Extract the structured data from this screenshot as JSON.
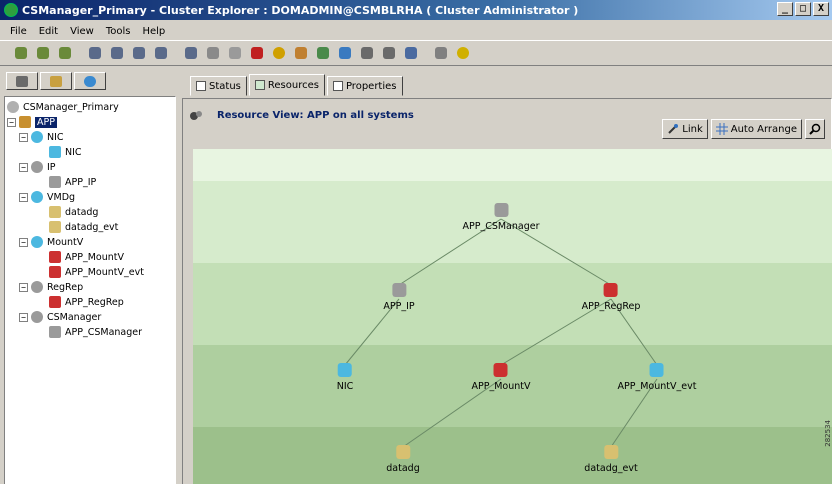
{
  "window": {
    "title": "CSManager_Primary - Cluster Explorer : DOMADMIN@CSMBLRHA ( Cluster Administrator )",
    "min": "_",
    "max": "□",
    "close": "X"
  },
  "menu": [
    "File",
    "Edit",
    "View",
    "Tools",
    "Help"
  ],
  "toolbar_icons": [
    "online-group-icon",
    "offline-group-icon",
    "switch-group-icon",
    "add-group-icon",
    "delete-group-icon",
    "modify-group-icon",
    "link-icon",
    "unlink-icon",
    "query-icon",
    "grid-icon",
    "stop-icon",
    "warning-icon",
    "wand-icon",
    "import-icon",
    "user-icon",
    "tag-icon",
    "export-icon",
    "report-icon",
    "tools-icon",
    "help-icon"
  ],
  "tree": {
    "root": "CSManager_Primary",
    "group": "APP",
    "resource_types": [
      {
        "name": "NIC",
        "resources": [
          "NIC"
        ]
      },
      {
        "name": "IP",
        "resources": [
          "APP_IP"
        ]
      },
      {
        "name": "VMDg",
        "resources": [
          "datadg",
          "datadg_evt"
        ]
      },
      {
        "name": "MountV",
        "resources": [
          "APP_MountV",
          "APP_MountV_evt"
        ]
      },
      {
        "name": "RegRep",
        "resources": [
          "APP_RegRep"
        ]
      },
      {
        "name": "CSManager",
        "resources": [
          "APP_CSManager"
        ]
      }
    ]
  },
  "tabs": {
    "status": "Status",
    "resources": "Resources",
    "properties": "Properties"
  },
  "view": {
    "title": "Resource View: APP on all systems",
    "link_label": "Link",
    "arrange_label": "Auto Arrange"
  },
  "graph": {
    "nodes": {
      "csmanager": "APP_CSManager",
      "ip": "APP_IP",
      "regrep": "APP_RegRep",
      "nic": "NIC",
      "mountv": "APP_MountV",
      "mountv_evt": "APP_MountV_evt",
      "datadg": "datadg",
      "datadg_evt": "datadg_evt"
    },
    "edges": [
      [
        "csmanager",
        "ip"
      ],
      [
        "csmanager",
        "regrep"
      ],
      [
        "ip",
        "nic"
      ],
      [
        "regrep",
        "mountv"
      ],
      [
        "regrep",
        "mountv_evt"
      ],
      [
        "mountv",
        "datadg"
      ],
      [
        "mountv_evt",
        "datadg_evt"
      ]
    ]
  },
  "side_code": "282534",
  "colors": {
    "title_blue": "#0a246a",
    "band1": "#e8f5e1",
    "band2": "#d6ebcc",
    "band3": "#c3dfb6",
    "band4": "#aecf9f",
    "band5": "#9cc08b",
    "resource_gray": "#9a9a9a",
    "resource_cyan": "#4cb8e0",
    "faulted_red": "#cc3030"
  }
}
